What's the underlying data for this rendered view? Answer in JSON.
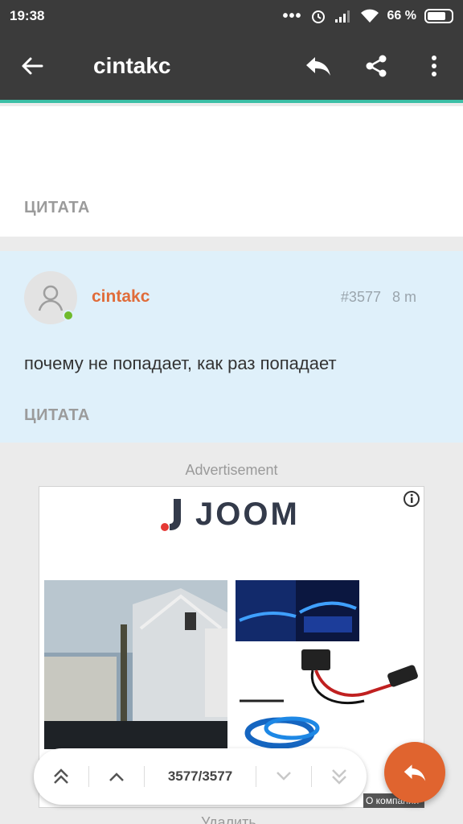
{
  "status_bar": {
    "time": "19:38",
    "dots": "•••",
    "battery_percent": "66 %"
  },
  "app_bar": {
    "title": "cintakc",
    "icons": [
      "back-arrow-icon",
      "reply-icon",
      "share-icon",
      "more-vert-icon"
    ]
  },
  "previous_post": {
    "quote_label": "ЦИТАТА"
  },
  "post": {
    "author": "cintakc",
    "number": "#3577",
    "time_ago": "8 m",
    "text": "почему не попадает, как раз попадает",
    "quote_label": "ЦИТАТА",
    "online": true
  },
  "advertisement": {
    "label": "Advertisement",
    "brand": "JOOM",
    "company_link": "О компании"
  },
  "below_ad_text": "Удалить",
  "pagination": {
    "counter": "3577/3577"
  },
  "colors": {
    "appbar": "#3b3b3b",
    "accent_line": "#3cbfa6",
    "author": "#e06c3a",
    "post_bg": "#dff0fa",
    "fab": "#e0642f",
    "online": "#6fba2c"
  }
}
